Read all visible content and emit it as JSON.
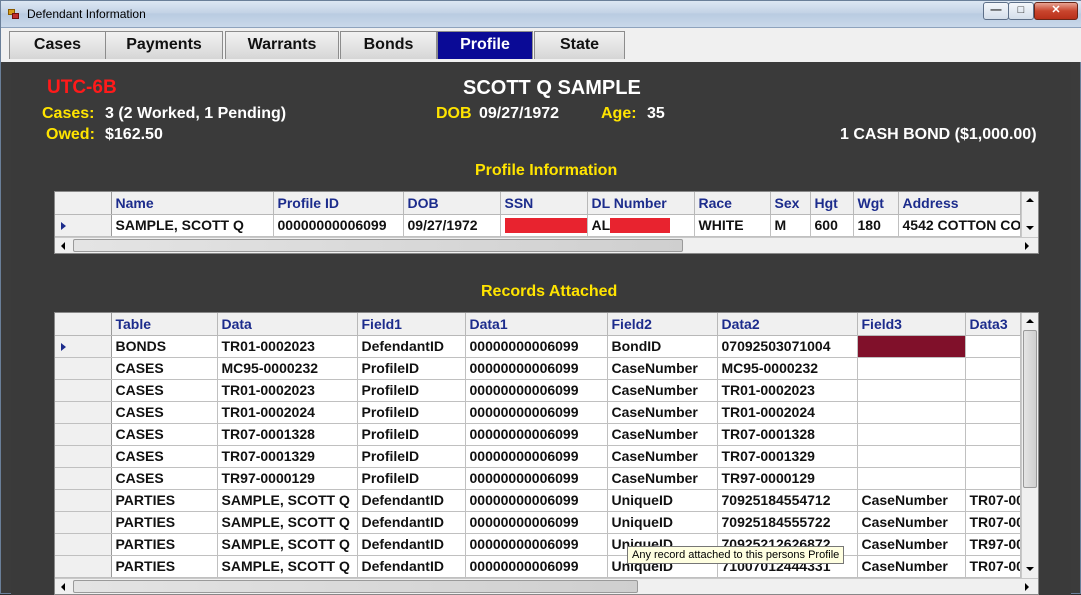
{
  "window": {
    "title": "Defendant Information",
    "min_label": "—",
    "max_label": "□",
    "close_label": "✕"
  },
  "tabs": [
    {
      "label": "Cases"
    },
    {
      "label": "Payments"
    },
    {
      "label": "Warrants"
    },
    {
      "label": "Bonds"
    },
    {
      "label": "Profile",
      "active": true
    },
    {
      "label": "State"
    }
  ],
  "header": {
    "code": "UTC-6B",
    "name": "SCOTT Q SAMPLE",
    "cases_label": "Cases:",
    "cases_value": "3 (2 Worked, 1 Pending)",
    "dob_label": "DOB",
    "dob_value": "09/27/1972",
    "age_label": "Age:",
    "age_value": "35",
    "owed_label": "Owed:",
    "owed_value": "$162.50",
    "bond_summary": "1 CASH BOND ($1,000.00)"
  },
  "profile": {
    "title": "Profile Information",
    "columns": [
      "Name",
      "Profile ID",
      "DOB",
      "SSN",
      "DL Number",
      "Race",
      "Sex",
      "Hgt",
      "Wgt",
      "Address"
    ],
    "row": {
      "name": "SAMPLE, SCOTT Q",
      "profile_id": "00000000006099",
      "dob": "09/27/1972",
      "ssn": "",
      "dl_prefix": "AL",
      "race": "WHITE",
      "sex": "M",
      "hgt": "600",
      "wgt": "180",
      "address": "4542 COTTON CO"
    }
  },
  "records": {
    "title": "Records Attached",
    "columns": [
      "Table",
      "Data",
      "Field1",
      "Data1",
      "Field2",
      "Data2",
      "Field3",
      "Data3"
    ],
    "rows": [
      [
        "BONDS",
        "TR01-0002023",
        "DefendantID",
        "00000000006099",
        "BondID",
        "07092503071004",
        "",
        ""
      ],
      [
        "CASES",
        "MC95-0000232",
        "ProfileID",
        "00000000006099",
        "CaseNumber",
        "MC95-0000232",
        "",
        ""
      ],
      [
        "CASES",
        "TR01-0002023",
        "ProfileID",
        "00000000006099",
        "CaseNumber",
        "TR01-0002023",
        "",
        ""
      ],
      [
        "CASES",
        "TR01-0002024",
        "ProfileID",
        "00000000006099",
        "CaseNumber",
        "TR01-0002024",
        "",
        ""
      ],
      [
        "CASES",
        "TR07-0001328",
        "ProfileID",
        "00000000006099",
        "CaseNumber",
        "TR07-0001328",
        "",
        ""
      ],
      [
        "CASES",
        "TR07-0001329",
        "ProfileID",
        "00000000006099",
        "CaseNumber",
        "TR07-0001329",
        "",
        ""
      ],
      [
        "CASES",
        "TR97-0000129",
        "ProfileID",
        "00000000006099",
        "CaseNumber",
        "TR97-0000129",
        "",
        ""
      ],
      [
        "PARTIES",
        "SAMPLE, SCOTT Q",
        "DefendantID",
        "00000000006099",
        "UniqueID",
        "70925184554712",
        "CaseNumber",
        "TR07-00"
      ],
      [
        "PARTIES",
        "SAMPLE, SCOTT Q",
        "DefendantID",
        "00000000006099",
        "UniqueID",
        "70925184555722",
        "CaseNumber",
        "TR07-00"
      ],
      [
        "PARTIES",
        "SAMPLE, SCOTT Q",
        "DefendantID",
        "00000000006099",
        "UniqueID",
        "70925212626872",
        "CaseNumber",
        "TR97-00"
      ],
      [
        "PARTIES",
        "SAMPLE, SCOTT Q",
        "DefendantID",
        "00000000006099",
        "UniqueID",
        "71007012444331",
        "CaseNumber",
        "TR07-00"
      ]
    ],
    "table_colors": [
      "blue",
      "blue",
      "gray",
      "gray",
      "gray",
      "gray",
      "gray",
      "blue",
      "gray",
      "gray",
      "gray"
    ]
  },
  "tooltip": "Any record attached to this persons Profile"
}
